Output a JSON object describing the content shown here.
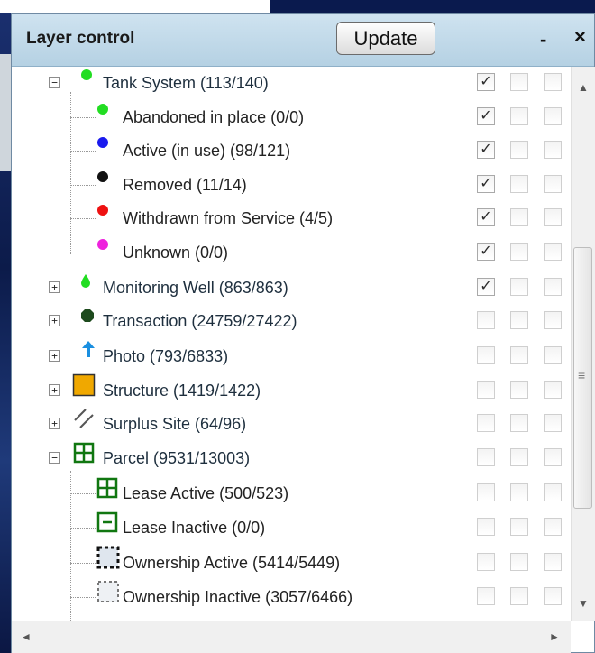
{
  "header": {
    "title": "Layer control",
    "update_label": "Update",
    "minimize_glyph": "-",
    "close_glyph": "×"
  },
  "layers": [
    {
      "label": "Tank System (113/140)",
      "expander": "−",
      "icon": "green-dot-icon",
      "checks": [
        true,
        false,
        false
      ]
    },
    {
      "label": "Abandoned in place (0/0)",
      "icon": "green-dot-icon",
      "checks": [
        true,
        false,
        false
      ]
    },
    {
      "label": "Active (in use) (98/121)",
      "icon": "blue-dot-icon",
      "checks": [
        true,
        false,
        false
      ]
    },
    {
      "label": "Removed (11/14)",
      "icon": "black-dot-icon",
      "checks": [
        true,
        false,
        false
      ]
    },
    {
      "label": "Withdrawn from Service (4/5)",
      "icon": "red-dot-icon",
      "checks": [
        true,
        false,
        false
      ]
    },
    {
      "label": "Unknown (0/0)",
      "icon": "magenta-dot-icon",
      "checks": [
        true,
        false,
        false
      ]
    },
    {
      "label": "Monitoring Well (863/863)",
      "expander": "+",
      "icon": "green-drop-icon",
      "checks": [
        true,
        false,
        false
      ]
    },
    {
      "label": "Transaction (24759/27422)",
      "expander": "+",
      "icon": "dark-green-octagon-icon",
      "checks": [
        false,
        false,
        false
      ]
    },
    {
      "label": "Photo (793/6833)",
      "expander": "+",
      "icon": "blue-up-arrow-icon",
      "checks": [
        false,
        false,
        false
      ]
    },
    {
      "label": "Structure (1419/1422)",
      "expander": "+",
      "icon": "orange-square-icon",
      "checks": [
        false,
        false,
        false
      ]
    },
    {
      "label": "Surplus Site (64/96)",
      "expander": "+",
      "icon": "hatch-lines-icon",
      "checks": [
        false,
        false,
        false
      ]
    },
    {
      "label": "Parcel (9531/13003)",
      "expander": "−",
      "icon": "green-grid-square-icon",
      "checks": [
        false,
        false,
        false
      ]
    },
    {
      "label": "Lease Active (500/523)",
      "icon": "green-grid-square-icon",
      "checks": [
        false,
        false,
        false
      ]
    },
    {
      "label": "Lease Inactive (0/0)",
      "icon": "green-minus-square-icon",
      "checks": [
        false,
        false,
        false
      ]
    },
    {
      "label": "Ownership Active (5414/5449)",
      "icon": "black-dashed-square-icon",
      "checks": [
        false,
        false,
        false
      ]
    },
    {
      "label": "Ownership Inactive (3057/6466)",
      "icon": "gray-dashed-square-icon",
      "checks": [
        false,
        false,
        false
      ]
    }
  ],
  "checkmark_glyph": "✓",
  "scrollbar": {
    "up_glyph": "▲",
    "down_glyph": "▼",
    "grip_glyph": "≡",
    "left_glyph": "◄",
    "right_glyph": "►"
  },
  "colors": {
    "header_bg": "#b5d1e3",
    "label_text": "#1e2f3e",
    "green": "#22dd22",
    "blue": "#1a1aee",
    "red": "#ee1111",
    "magenta": "#ee22dd",
    "orange": "#f0a800",
    "parcel_green": "#117711"
  }
}
